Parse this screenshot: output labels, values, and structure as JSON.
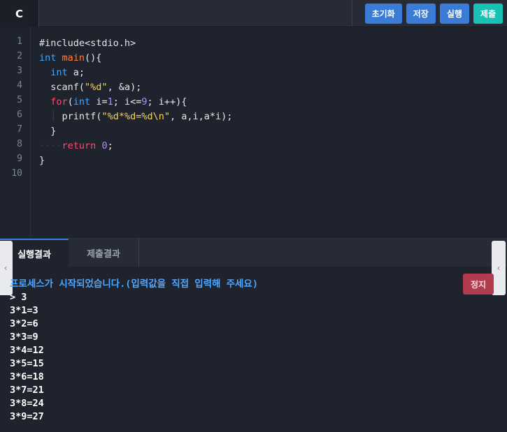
{
  "editor": {
    "language_tab": "C",
    "buttons": {
      "reset": "초기화",
      "save": "저장",
      "run": "실행",
      "submit": "제출"
    },
    "line_numbers": [
      "1",
      "2",
      "3",
      "4",
      "5",
      "6",
      "7",
      "8",
      "9",
      "10"
    ],
    "code": {
      "l1": "#include<stdio.h>",
      "l2_kw": "int",
      "l2_fn": "main",
      "l2_rest": "(){",
      "l3_kw": "int",
      "l3_rest": " a;",
      "l4_fn": "scanf",
      "l4_open": "(",
      "l4_str": "\"%d\"",
      "l4_rest": ", &a);",
      "l5_kw": "for",
      "l5_a": "(",
      "l5_kw2": "int",
      "l5_b": " i=",
      "l5_n1": "1",
      "l5_c": "; i<=",
      "l5_n2": "9",
      "l5_d": "; i++){",
      "l6_fn": "printf",
      "l6_open": "(",
      "l6_str": "\"%d*%d=%d\\n\"",
      "l6_rest": ", a,i,a*i);",
      "l7": "}",
      "l8_kw": "return",
      "l8_num": "0",
      "l8_rest": ";",
      "l9": "}"
    }
  },
  "bottom": {
    "tab_run_result": "실행결과",
    "tab_submit_result": "제출결과",
    "stop_label": "정지",
    "console": {
      "notice": "프로세스가 시작되었습니다.(입력값을 직접 입력해 주세요)",
      "input_line": "> 3",
      "output": [
        "3*1=3",
        "3*2=6",
        "3*3=9",
        "3*4=12",
        "3*5=15",
        "3*6=18",
        "3*7=21",
        "3*8=24",
        "3*9=27"
      ]
    }
  },
  "colors": {
    "accent_blue": "#3a7bd5",
    "submit_teal": "#17c2b4",
    "stop_red": "#b23b4e"
  },
  "icons": {
    "left_handle": "chevron-left-icon",
    "right_handle": "chevron-left-icon"
  }
}
